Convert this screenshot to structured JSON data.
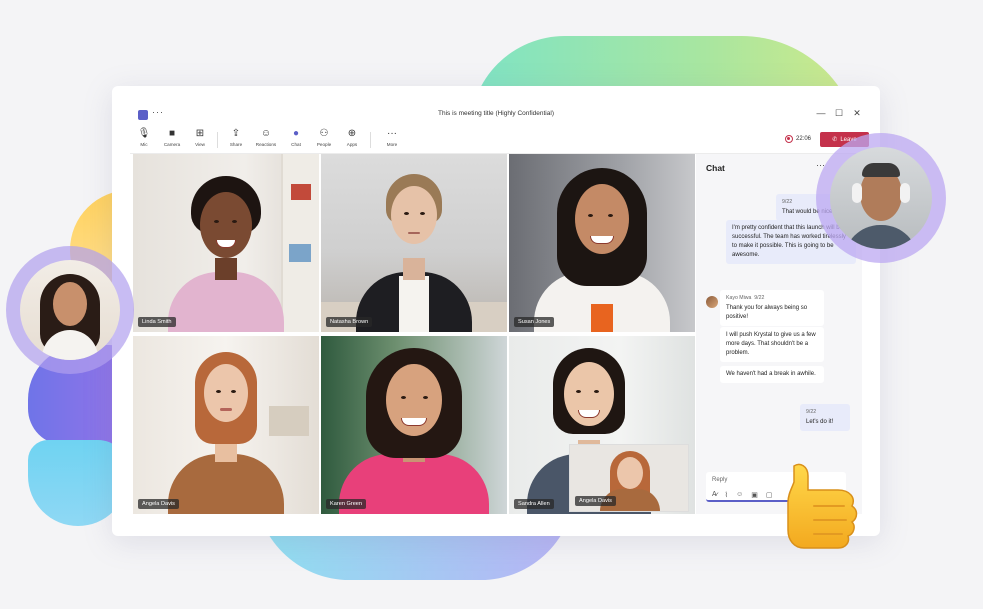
{
  "window": {
    "title": "This is meeting title (Highly Confidential)",
    "more": "···",
    "controls": [
      "—",
      "☐",
      "✕"
    ]
  },
  "toolbar": {
    "items": [
      {
        "icon": "mic-icon",
        "label": "Mic"
      },
      {
        "icon": "camera-icon",
        "label": "Camera"
      },
      {
        "icon": "view-icon",
        "label": "View"
      },
      {
        "icon": "share-icon",
        "label": "Share"
      },
      {
        "icon": "reactions-icon",
        "label": "Reactions"
      },
      {
        "icon": "chat-icon",
        "label": "Chat"
      },
      {
        "icon": "people-icon",
        "label": "People"
      },
      {
        "icon": "apps-icon",
        "label": "Apps"
      },
      {
        "icon": "more-icon",
        "label": "More"
      }
    ],
    "timer": "22:06",
    "leave_label": "Leave",
    "accent": "#5b5fc7",
    "leave_color": "#c4314b"
  },
  "participants": [
    {
      "name": "Linda Smith"
    },
    {
      "name": "Natasha Brown"
    },
    {
      "name": "Susan Jones"
    },
    {
      "name": "Angela Davis"
    },
    {
      "name": "Karen Green"
    },
    {
      "name": "Sandra Allen"
    }
  ],
  "pip": {
    "name": "Angela Davis"
  },
  "chat": {
    "title": "Chat",
    "more": "···",
    "messages": [
      {
        "from": "me",
        "date": "9/22",
        "text": "That would be nice"
      },
      {
        "from": "me",
        "text": "I'm pretty confident that this launch will be successful. The team has worked tirelessly to make it possible. This is going to be awesome."
      },
      {
        "from": "them",
        "author": "Kayo Miwa",
        "date": "9/22",
        "text": "Thank you for always being so positive!"
      },
      {
        "from": "them",
        "text": "I will push Krystal to give us a few more days. That shouldn't be a problem."
      },
      {
        "from": "them",
        "text": "We haven't had a break in awhile."
      },
      {
        "from": "me",
        "date": "9/22",
        "text": "Let's do it!"
      }
    ],
    "reply_placeholder": "Reply"
  }
}
